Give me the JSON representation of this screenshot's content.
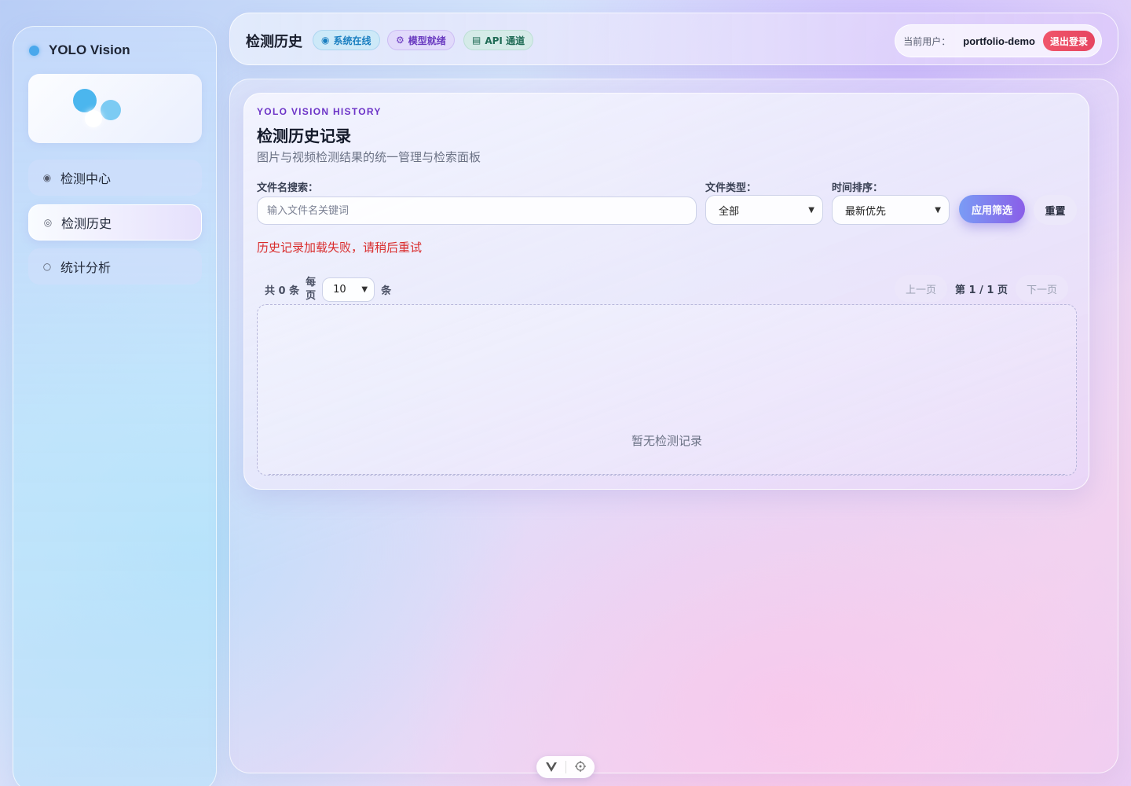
{
  "sidebar": {
    "brand": "YOLO Vision",
    "items": [
      {
        "label": "检测中心",
        "icon": "◉",
        "active": false
      },
      {
        "label": "检测历史",
        "icon": "◎",
        "active": true
      },
      {
        "label": "统计分析",
        "icon": "○",
        "active": false
      }
    ]
  },
  "topbar": {
    "title": "检测历史",
    "badges": {
      "online": {
        "icon": "◉",
        "label": "系统在线"
      },
      "model": {
        "icon": "⚙",
        "label": "模型就绪"
      },
      "api": {
        "icon": "▤",
        "label": "API 通道"
      }
    },
    "user_label": "当前用户：",
    "user_name": "portfolio-demo",
    "logout_label": "退出登录"
  },
  "history": {
    "eyebrow": "YOLO VISION HISTORY",
    "title": "检测历史记录",
    "subtitle": "图片与视频检测结果的统一管理与检索面板",
    "filters": {
      "search_label": "文件名搜索：",
      "search_placeholder": "输入文件名关键词",
      "type_label": "文件类型：",
      "type_value": "全部",
      "sort_label": "时间排序：",
      "sort_value": "最新优先",
      "apply_label": "应用筛选",
      "reset_label": "重置"
    },
    "error": "历史记录加载失败，请稍后重试",
    "total_text": "共 0 条",
    "per_page_prefix_1": "每",
    "per_page_prefix_2": "页",
    "per_page_value": "10",
    "per_page_suffix": "条",
    "pager": {
      "prev": "上一页",
      "info": "第 1 / 1 页",
      "next": "下一页"
    },
    "empty_text": "暂无检测记录"
  },
  "colors": {
    "accent_purple": "#6c33c7",
    "error_red": "#d92c2c",
    "logout_red": "#e64560",
    "brand_blue": "#4aa8ec"
  }
}
